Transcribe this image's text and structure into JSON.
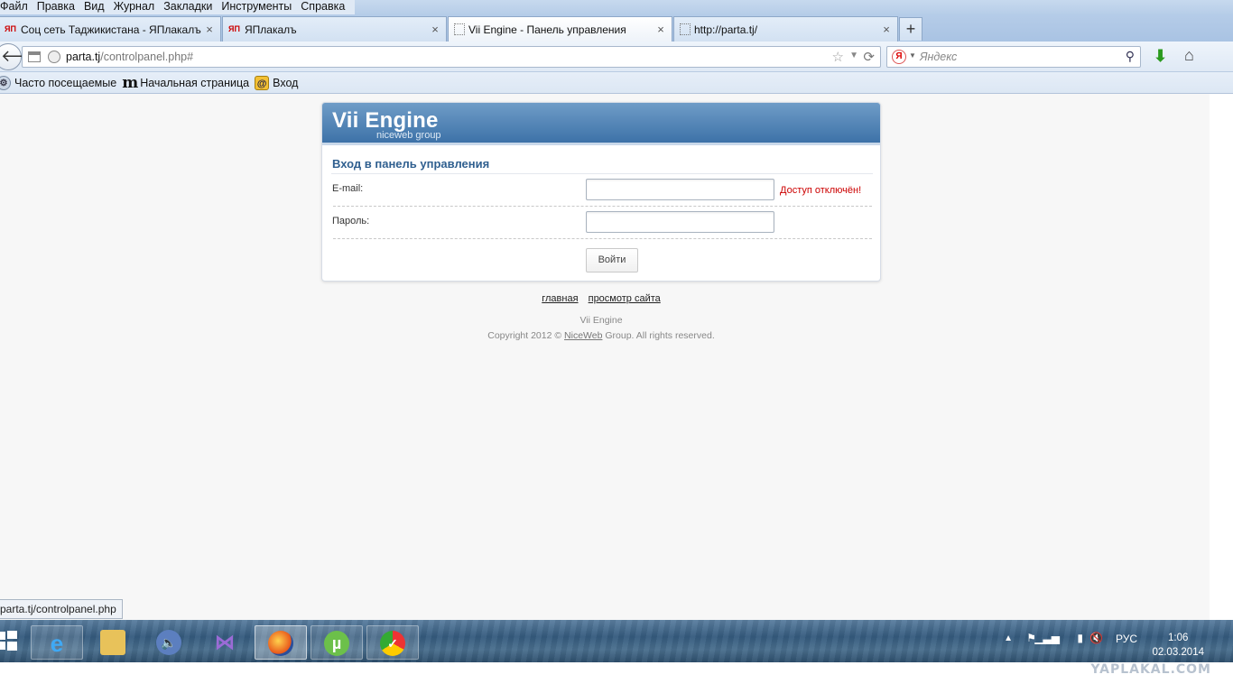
{
  "menubar": [
    "Файл",
    "Правка",
    "Вид",
    "Журнал",
    "Закладки",
    "Инструменты",
    "Справка"
  ],
  "tabs": [
    {
      "favicon": "ЯП",
      "label": "Соц сеть Таджикистана - ЯПлакалъ",
      "close": "×"
    },
    {
      "favicon": "ЯП",
      "label": "ЯПлакалъ",
      "close": "×"
    },
    {
      "favicon": "",
      "label": "Vii Engine - Панель управления",
      "close": "×"
    },
    {
      "favicon": "",
      "label": "http://parta.tj/",
      "close": "×"
    }
  ],
  "newtab_label": "+",
  "nav": {
    "back_glyph": "🡐",
    "url_host": "parta.tj",
    "url_path": "/controlpanel.php#",
    "search_placeholder": "Яндекс",
    "search_engine_glyph": "Я"
  },
  "bookmarks": [
    {
      "icon": "gear-icon",
      "label": "Часто посещаемые"
    },
    {
      "icon": "m-logo-icon",
      "label": "Начальная страница"
    },
    {
      "icon": "mail-at-icon",
      "label": "Вход"
    }
  ],
  "panel": {
    "brand": "Vii Engine",
    "brand_sub": "niceweb group",
    "title": "Вход в панель управления",
    "email_label": "E-mail:",
    "email_value": "",
    "error": "Доступ отключён!",
    "password_label": "Пароль:",
    "password_value": "",
    "submit_label": "Войти"
  },
  "footer": {
    "link_main": "главная",
    "link_view": "просмотр сайта",
    "product": "Vii Engine",
    "copyright_prefix": "Copyright 2012 © ",
    "copyright_link": "NiceWeb",
    "copyright_suffix": " Group. All rights reserved."
  },
  "statusbar": "parta.tj/controlpanel.php",
  "taskbar": {
    "lang": "РУС",
    "time": "1:06",
    "date": "02.03.2014"
  },
  "watermark": "YAPLAKAL.COM",
  "colors": {
    "header_blue": "#3d72a8",
    "title_blue": "#2f5f8f",
    "error_red": "#cc0000"
  }
}
